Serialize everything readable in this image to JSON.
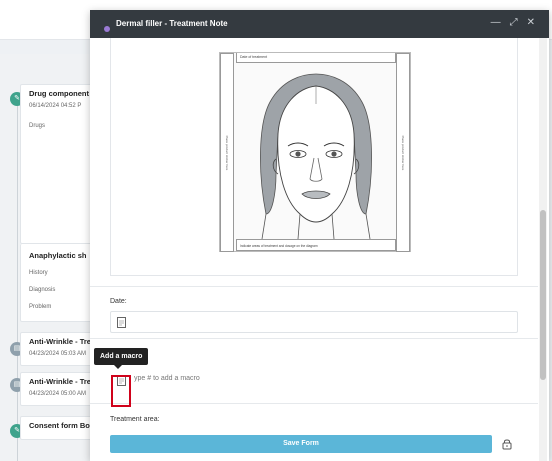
{
  "timeline": {
    "cards": [
      {
        "title": "Drug component",
        "date": "06/14/2024 04:52 P"
      },
      {
        "title": "Anti-Wrinkle - Treat",
        "date": "04/23/2024 05:03 AM"
      },
      {
        "title": "Anti-Wrinkle - Treat",
        "date": "04/23/2024 05:00 AM"
      },
      {
        "title": "Consent form Botox",
        "date": ""
      }
    ],
    "drug_label": "Drugs",
    "anaphylactic": "Anaphylactic sh",
    "rows": [
      "History",
      "Diagnosis",
      "Problem"
    ]
  },
  "modal": {
    "title": "Dermal filler - Treatment Note",
    "icons": [
      "minimize-icon",
      "expand-icon",
      "close-icon"
    ]
  },
  "diagram": {
    "header": "Date of treatment",
    "left_side": "Place product sticker here",
    "right_side": "Place product sticker here",
    "footer": "Indicate areas of treatment and dosage on the diagram"
  },
  "fields": {
    "date_label": "Date:",
    "macro_field_label": "r:",
    "macro_placeholder": "ype # to add a macro",
    "treatment_area_label": "Treatment area:"
  },
  "tooltip": "Add a macro",
  "footer": {
    "save_label": "Save Form"
  },
  "colors": {
    "header": "#343a40",
    "save": "#5bb6d8",
    "highlight": "#d0021b"
  }
}
